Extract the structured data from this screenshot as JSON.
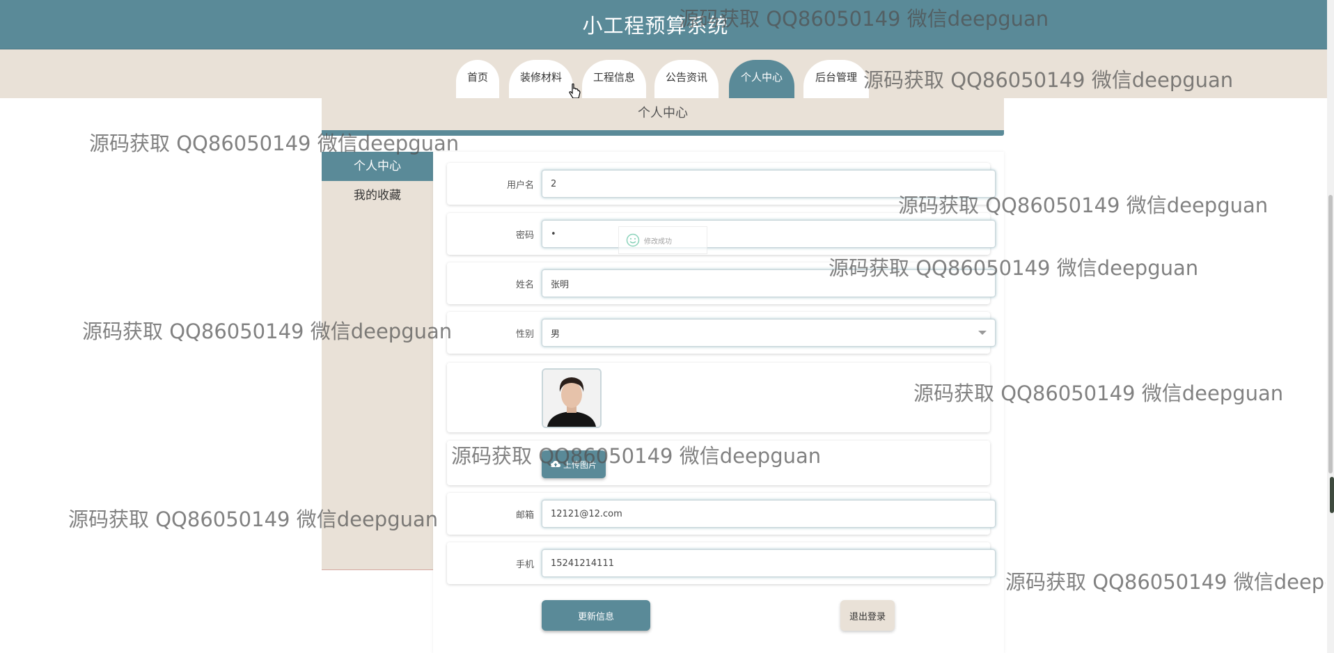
{
  "header": {
    "title": "小工程预算系统"
  },
  "nav": {
    "tabs": [
      {
        "label": "首页",
        "active": false
      },
      {
        "label": "装修材料",
        "active": false
      },
      {
        "label": "工程信息",
        "active": false
      },
      {
        "label": "公告资讯",
        "active": false
      },
      {
        "label": "个人中心",
        "active": true
      },
      {
        "label": "后台管理",
        "active": false
      }
    ]
  },
  "page": {
    "section_title": "个人中心"
  },
  "sidebar": {
    "items": [
      {
        "label": "个人中心",
        "active": true
      },
      {
        "label": "我的收藏",
        "active": false
      }
    ]
  },
  "form": {
    "username": {
      "label": "用户名",
      "value": "2"
    },
    "password": {
      "label": "密码",
      "value": "•"
    },
    "name": {
      "label": "姓名",
      "value": "张明"
    },
    "gender": {
      "label": "性别",
      "value": "男"
    },
    "upload_label": "上传图片",
    "email": {
      "label": "邮箱",
      "value": "12121@12.com"
    },
    "phone": {
      "label": "手机",
      "value": "15241214111"
    },
    "update_button": "更新信息",
    "logout_button": "退出登录"
  },
  "toast": {
    "text": "修改成功"
  },
  "watermark": {
    "text": "源码获取 QQ86050149 微信deepguan"
  },
  "colors": {
    "primary": "#5a8a98",
    "beige": "#e9e1d7"
  }
}
